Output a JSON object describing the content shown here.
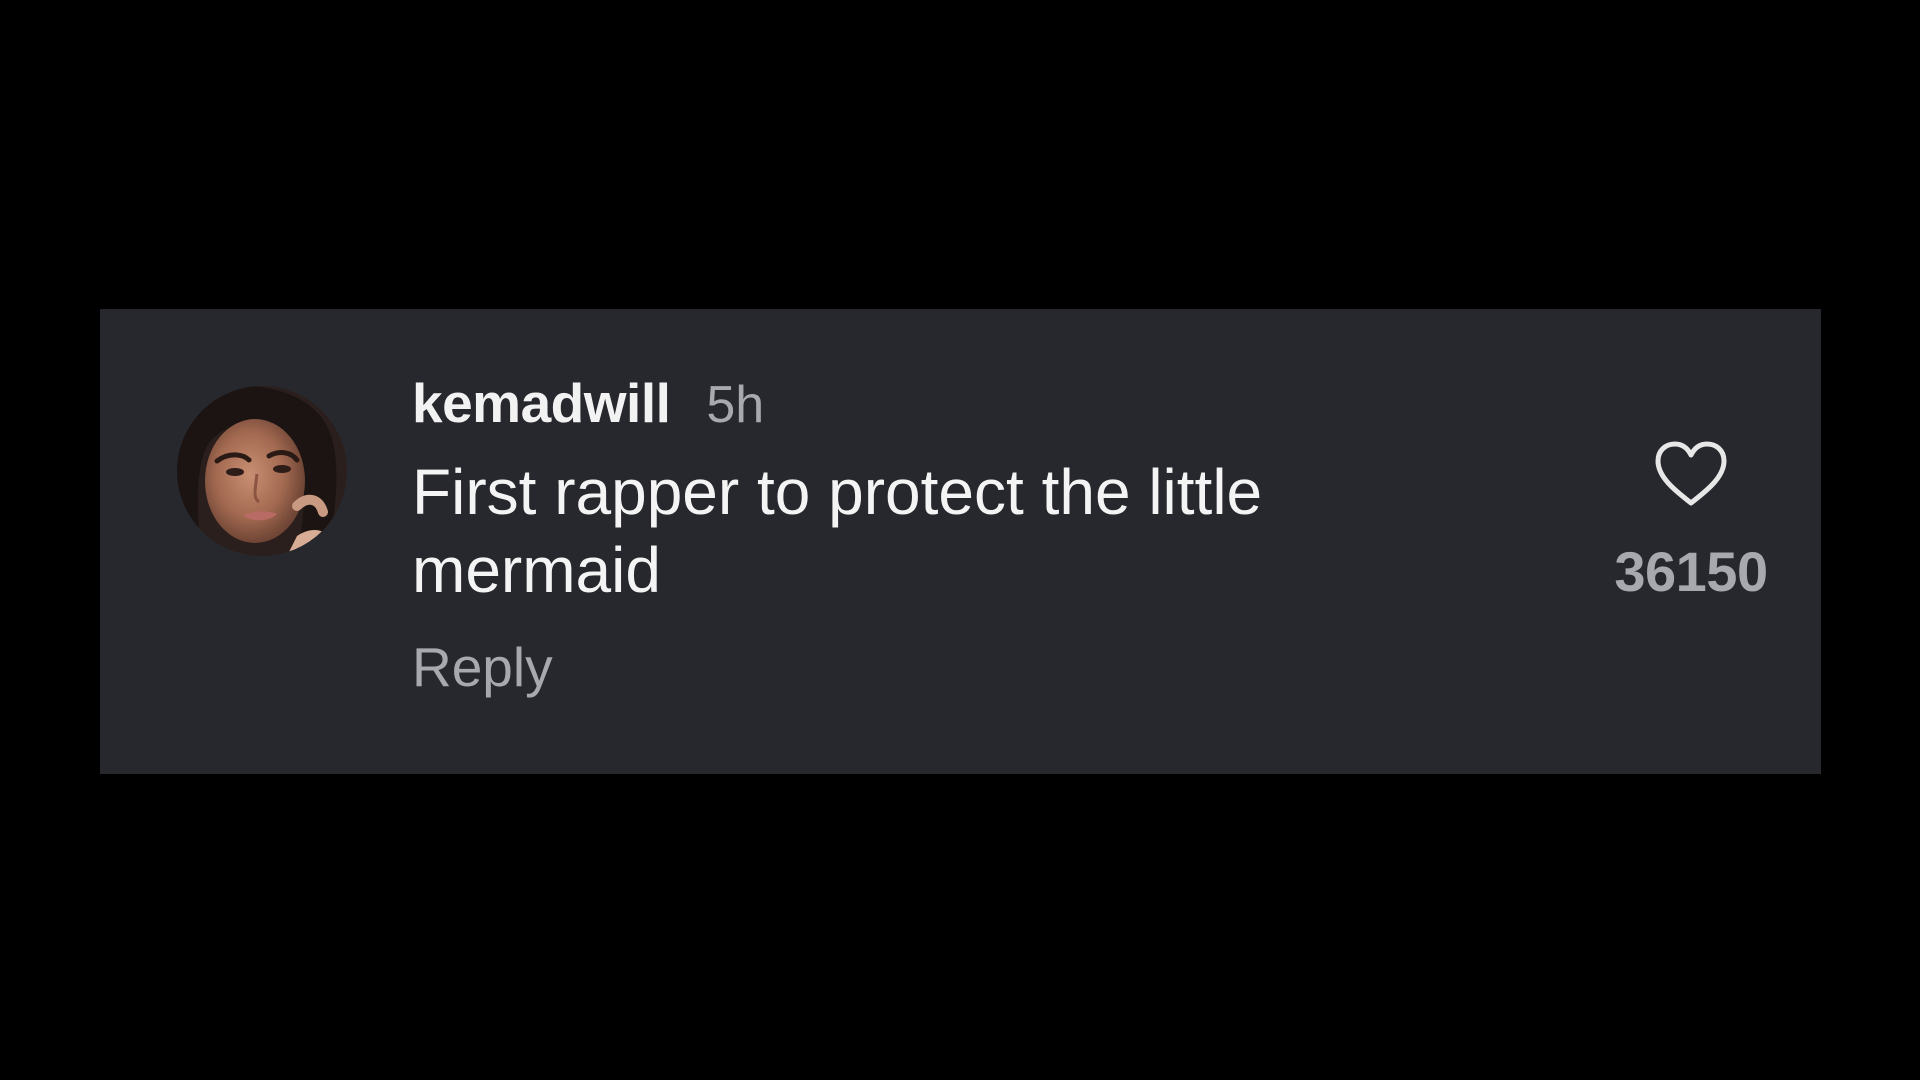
{
  "comment": {
    "username": "kemadwill",
    "timestamp": "5h",
    "text": "First rapper to protect the little mermaid",
    "reply_label": "Reply",
    "like_count": "36150",
    "avatar_icon": "user-avatar-photo",
    "like_icon": "heart-outline-icon"
  },
  "colors": {
    "page_background": "#000000",
    "card_background": "#26282d",
    "primary_text": "#f2f2f2",
    "secondary_text": "#a7a9ae"
  }
}
